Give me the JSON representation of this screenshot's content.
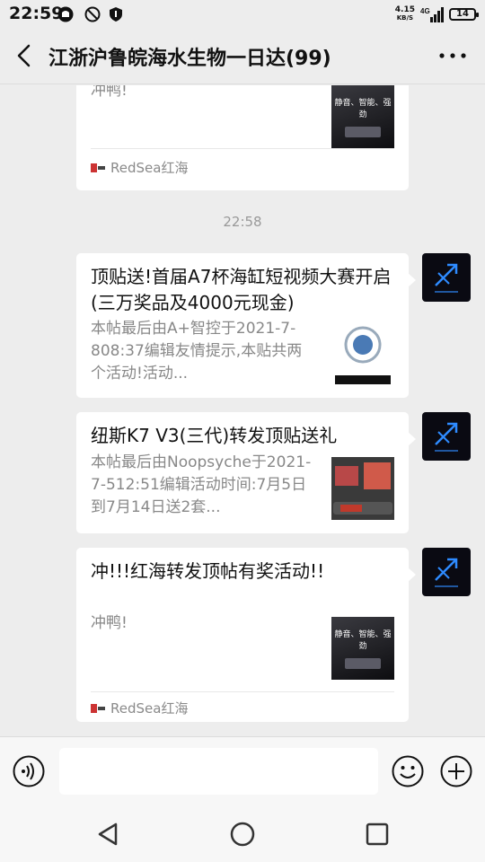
{
  "status_bar": {
    "time": "22:59",
    "net_speed_value": "4.15",
    "net_speed_unit": "KB/S",
    "network": "4G",
    "battery": "14"
  },
  "header": {
    "title": "江浙沪鲁皖海水生物一日达(99)",
    "back_icon": "chevron-left-icon",
    "more_icon": "more-dots-icon"
  },
  "messages": [
    {
      "type": "link_card_partial",
      "desc": "冲鸭!",
      "thumb_text": "静音、智能、强劲",
      "source": "RedSea红海"
    },
    {
      "type": "time",
      "text": "22:58"
    },
    {
      "type": "link_card",
      "title": "顶贴送!首届A7杯海缸短视频大赛开启(三万奖品及4000元现金)",
      "desc": "本帖最后由A+智控于2021-7-808:37编辑友情提示,本贴共两个活动!活动..."
    },
    {
      "type": "link_card",
      "title": "纽斯K7 V3(三代)转发顶贴送礼",
      "desc": "本帖最后由Noopsyche于2021-7-512:51编辑活动时间:7月5日到7月14日送2套..."
    },
    {
      "type": "link_card",
      "title": "冲!!!红海转发顶帖有奖活动!!",
      "desc": "冲鸭!",
      "thumb_text": "静音、智能、强劲",
      "source": "RedSea红海"
    }
  ],
  "input_bar": {
    "voice_icon": "voice-icon",
    "emoji_icon": "emoji-icon",
    "plus_icon": "plus-icon"
  },
  "nav_bar": {
    "back_icon": "triangle-back-icon",
    "home_icon": "circle-home-icon",
    "recents_icon": "square-recents-icon"
  },
  "colors": {
    "background": "#ededed",
    "card": "#ffffff",
    "avatar": "#0a0a12",
    "avatar_accent": "#2e8bff"
  }
}
